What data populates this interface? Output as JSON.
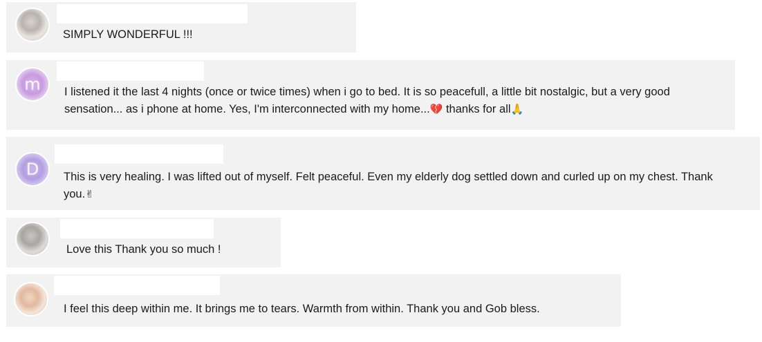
{
  "comments": [
    {
      "avatar": "blurred-photo",
      "author": "",
      "text": "SIMPLY WONDERFUL !!!"
    },
    {
      "avatar": "letter-avatar",
      "avatar_letter": "m",
      "avatar_color": "#c79be0",
      "author": "",
      "text_line1": "I listened it the last 4 nights (once or twice times) when i go to bed. It is so peacefull, a little bit nostalgic, but a very good",
      "text_line2_part1": "sensation... as i phone at home. Yes, I'm interconnected with my home...",
      "emoji1": "💔",
      "text_line2_part2": " thanks for all",
      "emoji2": "🙏"
    },
    {
      "avatar": "letter-avatar",
      "avatar_letter": "D",
      "avatar_color": "#b39ee0",
      "author": "",
      "text_line1": "This is very healing. I was lifted out of myself. Felt peaceful. Even my elderly dog settled down and curled up on my chest. Thank",
      "text_line2": "you.",
      "emoji": "✌"
    },
    {
      "avatar": "blurred-photo",
      "author": "",
      "text": "Love this Thank you so much !"
    },
    {
      "avatar": "blurred-photo",
      "author": "",
      "text": "I feel this deep within me. It brings me to tears. Warmth from within. Thank you and Gob bless."
    }
  ]
}
